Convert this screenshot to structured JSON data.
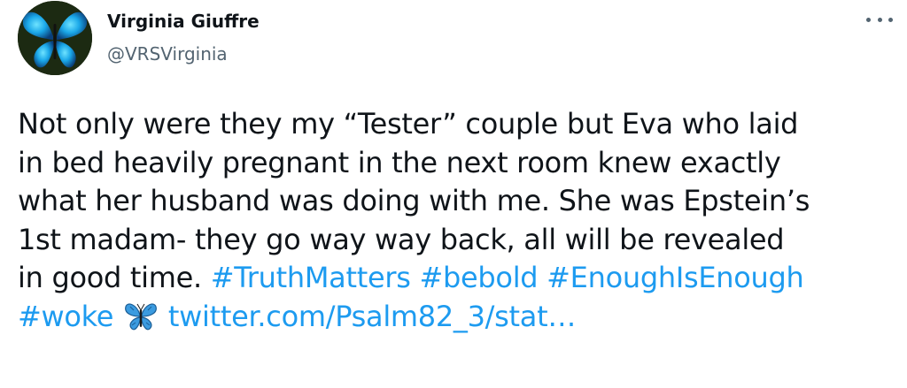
{
  "tweet": {
    "display_name": "Virginia Giuffre",
    "handle": "@VRSVirginia",
    "more_icon": "more-horizontal-icon",
    "avatar_icon": "blue-butterfly",
    "lines": [
      "Not only were they my “Tester” couple but Eva who laid",
      "in bed heavily pregnant in the next room knew exactly",
      "what her husband was doing with me. She was Epstein’s",
      "1st madam- they go way way back, all will be revealed"
    ],
    "line5_text": "in good time. ",
    "hashtags": [
      "#TruthMatters",
      "#bebold",
      "#EnoughIsEnough",
      "#woke"
    ],
    "emoji": "butterfly-emoji",
    "link": "twitter.com/Psalm82_3/stat…",
    "colors": {
      "link": "#1d9bf0",
      "text": "#0f1419",
      "secondary": "#536471"
    }
  }
}
